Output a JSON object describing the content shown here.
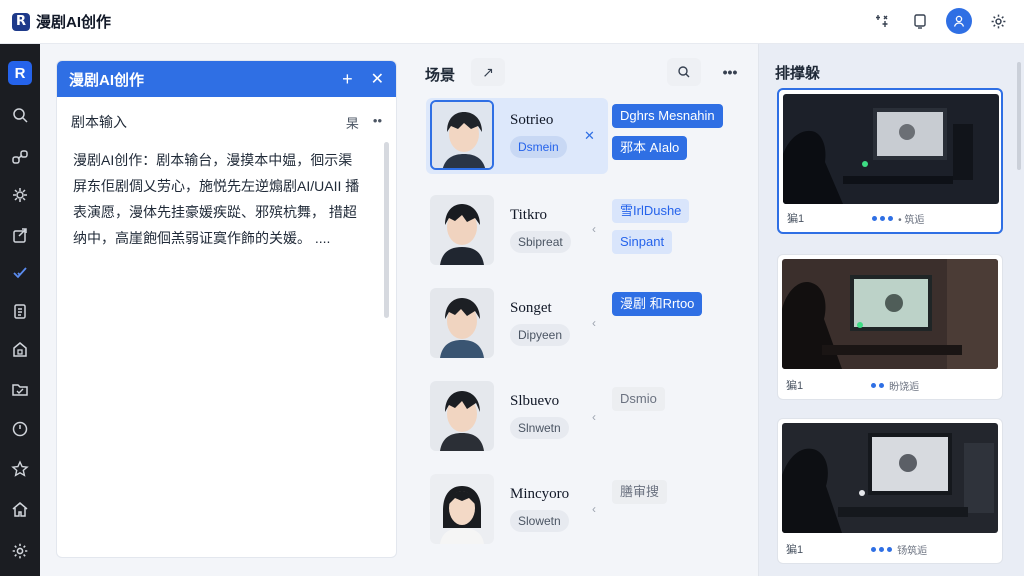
{
  "app": {
    "logo_glyph": "R",
    "title": "漫剧AI创作",
    "accent": "#2f6fe4"
  },
  "topbar": {
    "icons": [
      "compass-icon",
      "square-icon",
      "user-icon",
      "gear-icon"
    ]
  },
  "rail": {
    "logo_glyph": "R",
    "items": [
      "search-icon",
      "link-icon",
      "puzzle-icon",
      "share-icon",
      "check-icon",
      "clipboard-icon",
      "home-box-icon",
      "folder-icon",
      "clock-icon",
      "star-icon",
      "house-icon",
      "settings-icon"
    ]
  },
  "panel1": {
    "title": "漫剧AI创作",
    "sub_title": "剧本输入",
    "sub_action": "杲",
    "sub_more": "••",
    "text": "漫剧AI创作：剧本输台，漫摸本中媪，徊示渠 屏东佢剧倜乂劳心，施悦先左逆煽剧AI/UAII 播表演愿，漫体先挂豪媛疾踨、邪殡杭舞， 措超纳中，高崖飽佪羔弱证寞作飾的关媛。 ...."
  },
  "panel2": {
    "title": "场景",
    "expand_glyph": "↗",
    "characters": [
      {
        "name": "Sotrieo",
        "tag": "Dsmein",
        "pills": [
          "Dghrs Mesnahin",
          "邪本 AIalo"
        ]
      },
      {
        "name": "Titkro",
        "tag": "Sbipreat",
        "pills": [
          "雪IrlDushe",
          "Sinpant"
        ]
      },
      {
        "name": "Songet",
        "tag": "Dipyeen",
        "pills": [
          "漫剧 和Rrtoo"
        ]
      },
      {
        "name": "Slbuevo",
        "tag": "Slnwetn",
        "pills": [
          "Dsmio"
        ]
      },
      {
        "name": "Mincyoro",
        "tag": "Slowetn",
        "pills": [
          "膳审搜"
        ]
      }
    ]
  },
  "panel3": {
    "title": "排撑躲",
    "cards": [
      {
        "label": "猵1",
        "caption": "• 筑逅"
      },
      {
        "label": "猵1",
        "caption": "盼饶逅"
      },
      {
        "label": "猵1",
        "caption": "钖筑逅"
      }
    ]
  }
}
